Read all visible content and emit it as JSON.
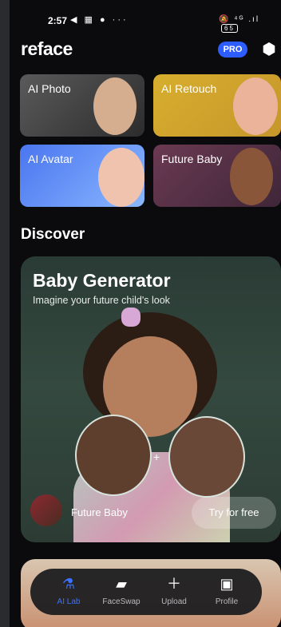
{
  "status_bar": {
    "time": "2:57",
    "left_icons": "◀ ▦ ● ···",
    "right_icons": "🔕 ⁴ᴳ .ıl",
    "battery": "65"
  },
  "header": {
    "logo": "reface",
    "pro_label": "PRO",
    "settings_icon": "settings-icon"
  },
  "features": [
    {
      "label": "AI Photo"
    },
    {
      "label": "AI Retouch"
    },
    {
      "label": "AI Avatar"
    },
    {
      "label": "Future Baby"
    }
  ],
  "discover": {
    "title": "Discover",
    "hero": {
      "title": "Baby Generator",
      "subtitle": "Imagine your future child's look",
      "tag_label": "Future Baby",
      "cta": "Try for free"
    }
  },
  "nav": [
    {
      "label": "AI Lab",
      "icon": "flask-icon",
      "active": true
    },
    {
      "label": "FaceSwap",
      "icon": "stack-icon",
      "active": false
    },
    {
      "label": "Upload",
      "icon": "plus-icon",
      "active": false
    },
    {
      "label": "Profile",
      "icon": "profile-icon",
      "active": false
    }
  ],
  "colors": {
    "accent": "#3b72ff",
    "pro_badge": "#2d5cff",
    "background": "#0b0b0d"
  }
}
